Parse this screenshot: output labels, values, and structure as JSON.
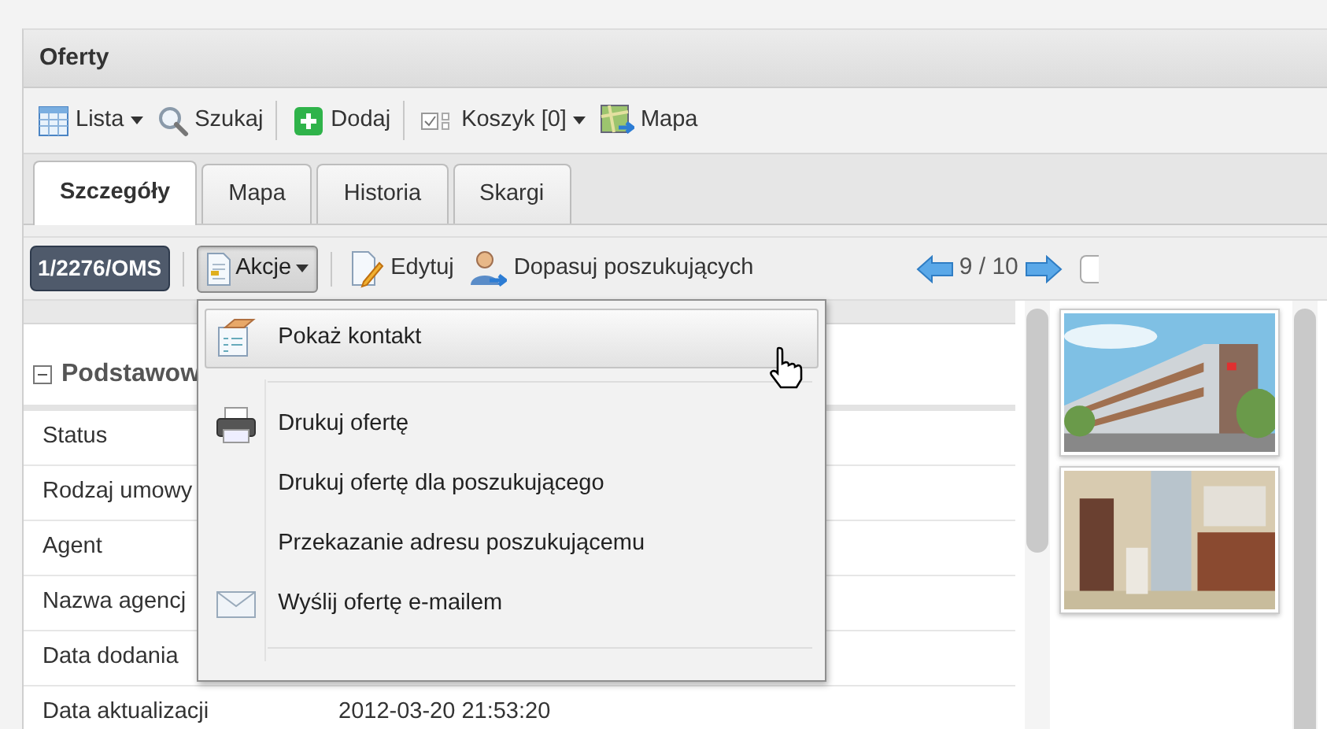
{
  "panel": {
    "title": "Oferty"
  },
  "toolbar": [
    {
      "label": "Lista",
      "caret": true,
      "separator_after": false
    },
    {
      "label": "Szukaj",
      "caret": false,
      "separator_after": true
    },
    {
      "label": "Dodaj",
      "caret": false,
      "separator_after": true
    },
    {
      "label": "Koszyk [0]",
      "caret": true,
      "separator_after": false
    },
    {
      "label": "Mapa",
      "caret": false,
      "separator_after": false
    }
  ],
  "tabs": [
    {
      "label": "Szczegóły",
      "selected": true
    },
    {
      "label": "Mapa",
      "selected": false
    },
    {
      "label": "Historia",
      "selected": false
    },
    {
      "label": "Skargi",
      "selected": false
    }
  ],
  "record_bar": {
    "id_badge": "1/2276/OMS",
    "actions": {
      "label": "Akcje",
      "expanded": true
    },
    "buttons": [
      "Edytuj",
      "Dopasuj poszukujących"
    ],
    "pager": "9 / 10",
    "select_checkbox": {
      "checked": false
    }
  },
  "section": {
    "title": "Podstawow",
    "expanded": true
  },
  "rows": [
    {
      "label": "Status"
    },
    {
      "label": "Rodzaj umowy"
    },
    {
      "label": "Agent"
    },
    {
      "label": "Nazwa agencj"
    },
    {
      "label": "Data dodania"
    },
    {
      "label": "Data aktualizacji",
      "value": "2012-03-20 21:53:20"
    }
  ],
  "menu": [
    {
      "label": "Pokaż kontakt",
      "hovered": true,
      "separator_after": true
    },
    {
      "label": "Drukuj ofertę",
      "hovered": false,
      "separator_after": false
    },
    {
      "label": "Drukuj ofertę dla poszukującego",
      "hovered": false,
      "separator_after": false
    },
    {
      "label": "Przekazanie adresu poszukującemu",
      "hovered": false,
      "separator_after": false
    },
    {
      "label": "Wyślij ofertę e-mailem",
      "hovered": false,
      "separator_after": true
    }
  ]
}
